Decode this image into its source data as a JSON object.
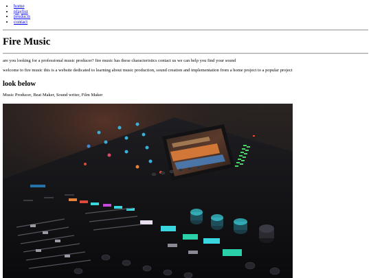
{
  "nav": {
    "items": [
      {
        "label": "home"
      },
      {
        "label": "playlist"
      },
      {
        "label": "products"
      },
      {
        "label": "contact"
      }
    ]
  },
  "header": {
    "title": "Fire Music"
  },
  "main": {
    "intro": "are you looking for a professional music producer? fire music has these characteristics contact us we can help you find your sound",
    "welcome": "welcome to fire music this is a website dedicated to learning about music production, sound creation and implementation from a home project to a popular project",
    "section_heading": "look below",
    "roles": "Music Producer, Beat Maker, Sound writer, Film Maker"
  },
  "photo": {
    "subject": "mixing-console"
  },
  "colors": {
    "link": "#0000ee",
    "rule": "#a3a3a3",
    "screen_orange": "#e8833a",
    "meter_green": "#46d86a",
    "knob_cyan": "#3ad6e0"
  }
}
